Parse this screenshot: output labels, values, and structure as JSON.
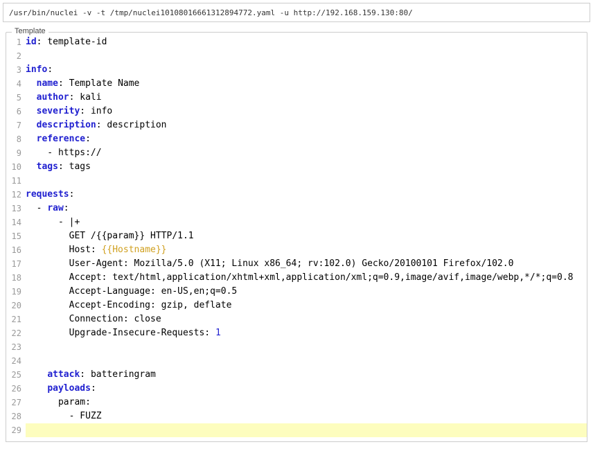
{
  "command": "/usr/bin/nuclei -v -t /tmp/nuclei10108016661312894772.yaml -u http://192.168.159.130:80/",
  "section_label": "Template",
  "lines": [
    {
      "n": 1,
      "parts": [
        {
          "t": "id",
          "c": "key"
        },
        {
          "t": ": ",
          "c": "colon"
        },
        {
          "t": "template-id",
          "c": "val"
        }
      ]
    },
    {
      "n": 2,
      "parts": []
    },
    {
      "n": 3,
      "parts": [
        {
          "t": "info",
          "c": "key"
        },
        {
          "t": ":",
          "c": "colon"
        }
      ]
    },
    {
      "n": 4,
      "parts": [
        {
          "t": "  ",
          "c": ""
        },
        {
          "t": "name",
          "c": "key"
        },
        {
          "t": ": ",
          "c": "colon"
        },
        {
          "t": "Template Name",
          "c": "val"
        }
      ]
    },
    {
      "n": 5,
      "parts": [
        {
          "t": "  ",
          "c": ""
        },
        {
          "t": "author",
          "c": "key"
        },
        {
          "t": ": ",
          "c": "colon"
        },
        {
          "t": "kali",
          "c": "val"
        }
      ]
    },
    {
      "n": 6,
      "parts": [
        {
          "t": "  ",
          "c": ""
        },
        {
          "t": "severity",
          "c": "key"
        },
        {
          "t": ": ",
          "c": "colon"
        },
        {
          "t": "info",
          "c": "val"
        }
      ]
    },
    {
      "n": 7,
      "parts": [
        {
          "t": "  ",
          "c": ""
        },
        {
          "t": "description",
          "c": "key"
        },
        {
          "t": ": ",
          "c": "colon"
        },
        {
          "t": "description",
          "c": "val"
        }
      ]
    },
    {
      "n": 8,
      "parts": [
        {
          "t": "  ",
          "c": ""
        },
        {
          "t": "reference",
          "c": "key"
        },
        {
          "t": ":",
          "c": "colon"
        }
      ]
    },
    {
      "n": 9,
      "parts": [
        {
          "t": "    - https://",
          "c": "val"
        }
      ]
    },
    {
      "n": 10,
      "parts": [
        {
          "t": "  ",
          "c": ""
        },
        {
          "t": "tags",
          "c": "key"
        },
        {
          "t": ": ",
          "c": "colon"
        },
        {
          "t": "tags",
          "c": "val"
        }
      ]
    },
    {
      "n": 11,
      "parts": []
    },
    {
      "n": 12,
      "parts": [
        {
          "t": "requests",
          "c": "key"
        },
        {
          "t": ":",
          "c": "colon"
        }
      ]
    },
    {
      "n": 13,
      "parts": [
        {
          "t": "  - ",
          "c": "val"
        },
        {
          "t": "raw",
          "c": "key"
        },
        {
          "t": ":",
          "c": "colon"
        }
      ]
    },
    {
      "n": 14,
      "parts": [
        {
          "t": "      - |+",
          "c": "val"
        }
      ]
    },
    {
      "n": 15,
      "parts": [
        {
          "t": "        GET /{{param}} HTTP/1.1",
          "c": "val"
        }
      ]
    },
    {
      "n": 16,
      "parts": [
        {
          "t": "        Host: ",
          "c": "val"
        },
        {
          "t": "{{Hostname}}",
          "c": "mustache"
        }
      ]
    },
    {
      "n": 17,
      "parts": [
        {
          "t": "        User-Agent: Mozilla/5.0 (X11; Linux x86_64; rv:102.0) Gecko/20100101 Firefox/102.0",
          "c": "val"
        }
      ]
    },
    {
      "n": 18,
      "parts": [
        {
          "t": "        Accept: text/html,application/xhtml+xml,application/xml;q=0.9,image/avif,image/webp,*/*;q=0.8",
          "c": "val"
        }
      ]
    },
    {
      "n": 19,
      "parts": [
        {
          "t": "        Accept-Language: en-US,en;q=0.5",
          "c": "val"
        }
      ]
    },
    {
      "n": 20,
      "parts": [
        {
          "t": "        Accept-Encoding: gzip, deflate",
          "c": "val"
        }
      ]
    },
    {
      "n": 21,
      "parts": [
        {
          "t": "        Connection: close",
          "c": "val"
        }
      ]
    },
    {
      "n": 22,
      "parts": [
        {
          "t": "        Upgrade-Insecure-Requests: ",
          "c": "val"
        },
        {
          "t": "1",
          "c": "num"
        }
      ]
    },
    {
      "n": 23,
      "parts": []
    },
    {
      "n": 24,
      "parts": []
    },
    {
      "n": 25,
      "parts": [
        {
          "t": "    ",
          "c": ""
        },
        {
          "t": "attack",
          "c": "key"
        },
        {
          "t": ": ",
          "c": "colon"
        },
        {
          "t": "batteringram",
          "c": "val"
        }
      ]
    },
    {
      "n": 26,
      "parts": [
        {
          "t": "    ",
          "c": ""
        },
        {
          "t": "payloads",
          "c": "key"
        },
        {
          "t": ":",
          "c": "colon"
        }
      ]
    },
    {
      "n": 27,
      "parts": [
        {
          "t": "      param:",
          "c": "val"
        }
      ]
    },
    {
      "n": 28,
      "parts": [
        {
          "t": "        - FUZZ",
          "c": "val"
        }
      ]
    },
    {
      "n": 29,
      "parts": [],
      "hl": true
    }
  ]
}
